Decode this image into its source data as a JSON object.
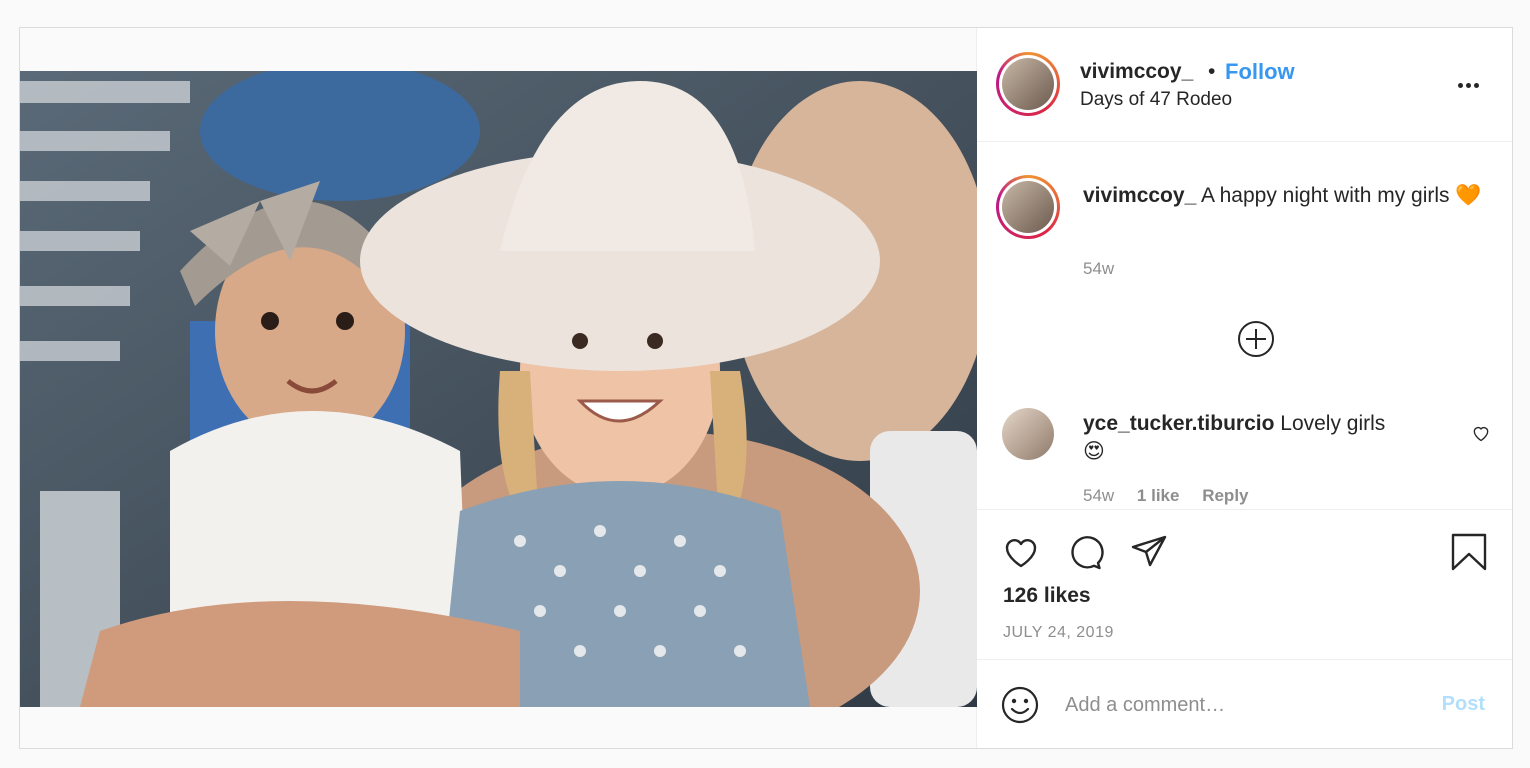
{
  "post": {
    "username": "vivimccoy_",
    "separator": "•",
    "follow_label": "Follow",
    "location": "Days of 47 Rodeo",
    "more_icon": "more-horizontal-icon",
    "photo_alt": "Two young girls at a rodeo, one wearing a white cowboy hat"
  },
  "caption": {
    "username": "vivimccoy_",
    "text": "A happy night with my girls",
    "emoji": "🧡",
    "time": "54w",
    "load_more_icon": "plus-circle-icon"
  },
  "comments": [
    {
      "username": "yce_tucker.tiburcio",
      "text": "Lovely girls",
      "emoji": "😍",
      "time": "54w",
      "likes": "1 like",
      "reply_label": "Reply"
    }
  ],
  "actions": {
    "like_icon": "heart-icon",
    "comment_icon": "comment-icon",
    "share_icon": "send-icon",
    "save_icon": "bookmark-icon",
    "likes_text": "126 likes",
    "date": "JULY 24, 2019"
  },
  "add_comment": {
    "emoji_icon": "smiley-icon",
    "placeholder": "Add a comment…",
    "post_label": "Post"
  },
  "colors": {
    "link_blue": "#3897f0",
    "post_disabled": "#b2dffc",
    "muted": "#8e8e8e"
  }
}
